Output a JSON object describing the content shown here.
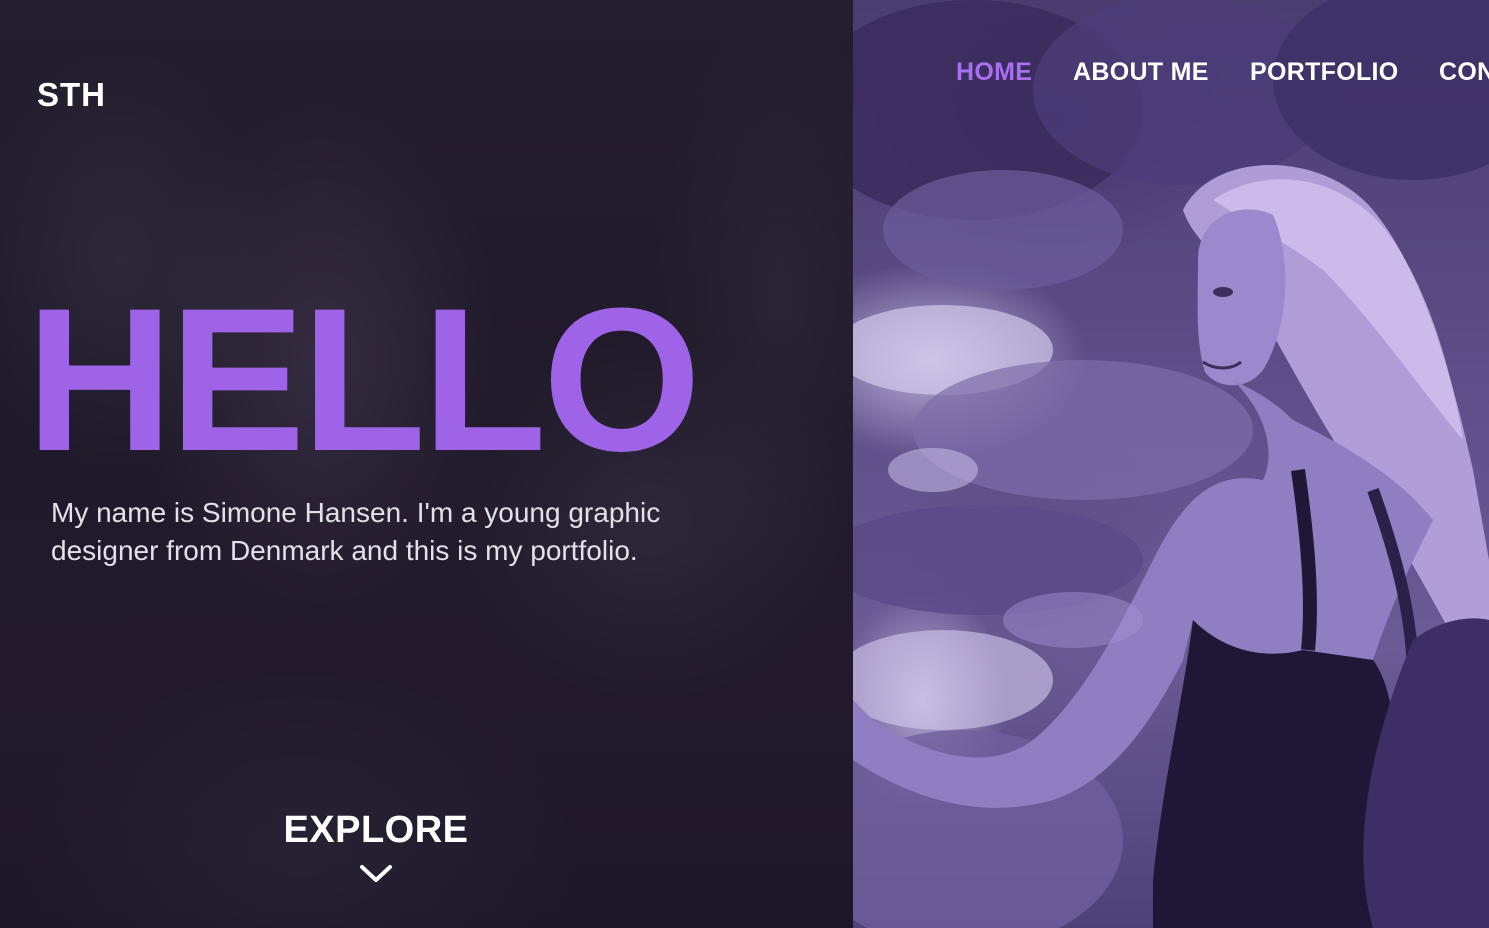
{
  "brand": {
    "logo_text": "STH"
  },
  "nav": {
    "items": [
      {
        "label": "HOME",
        "active": true
      },
      {
        "label": "ABOUT ME",
        "active": false
      },
      {
        "label": "PORTFOLIO",
        "active": false
      },
      {
        "label": "CON",
        "active": false
      }
    ]
  },
  "hero": {
    "title": "HELLO",
    "intro": "My name is Simone Hansen. I'm a young graphic designer from Denmark and this is my portfolio.",
    "explore_label": "EXPLORE",
    "explore_icon": "chevron-down-icon"
  },
  "colors": {
    "accent": "#9e63e6",
    "nav_active": "#a86ff0",
    "text_primary": "#ffffff",
    "text_body": "#e4e0ea",
    "left_panel_bg": "#251e2f",
    "right_panel_tint": "#5d4d88"
  }
}
